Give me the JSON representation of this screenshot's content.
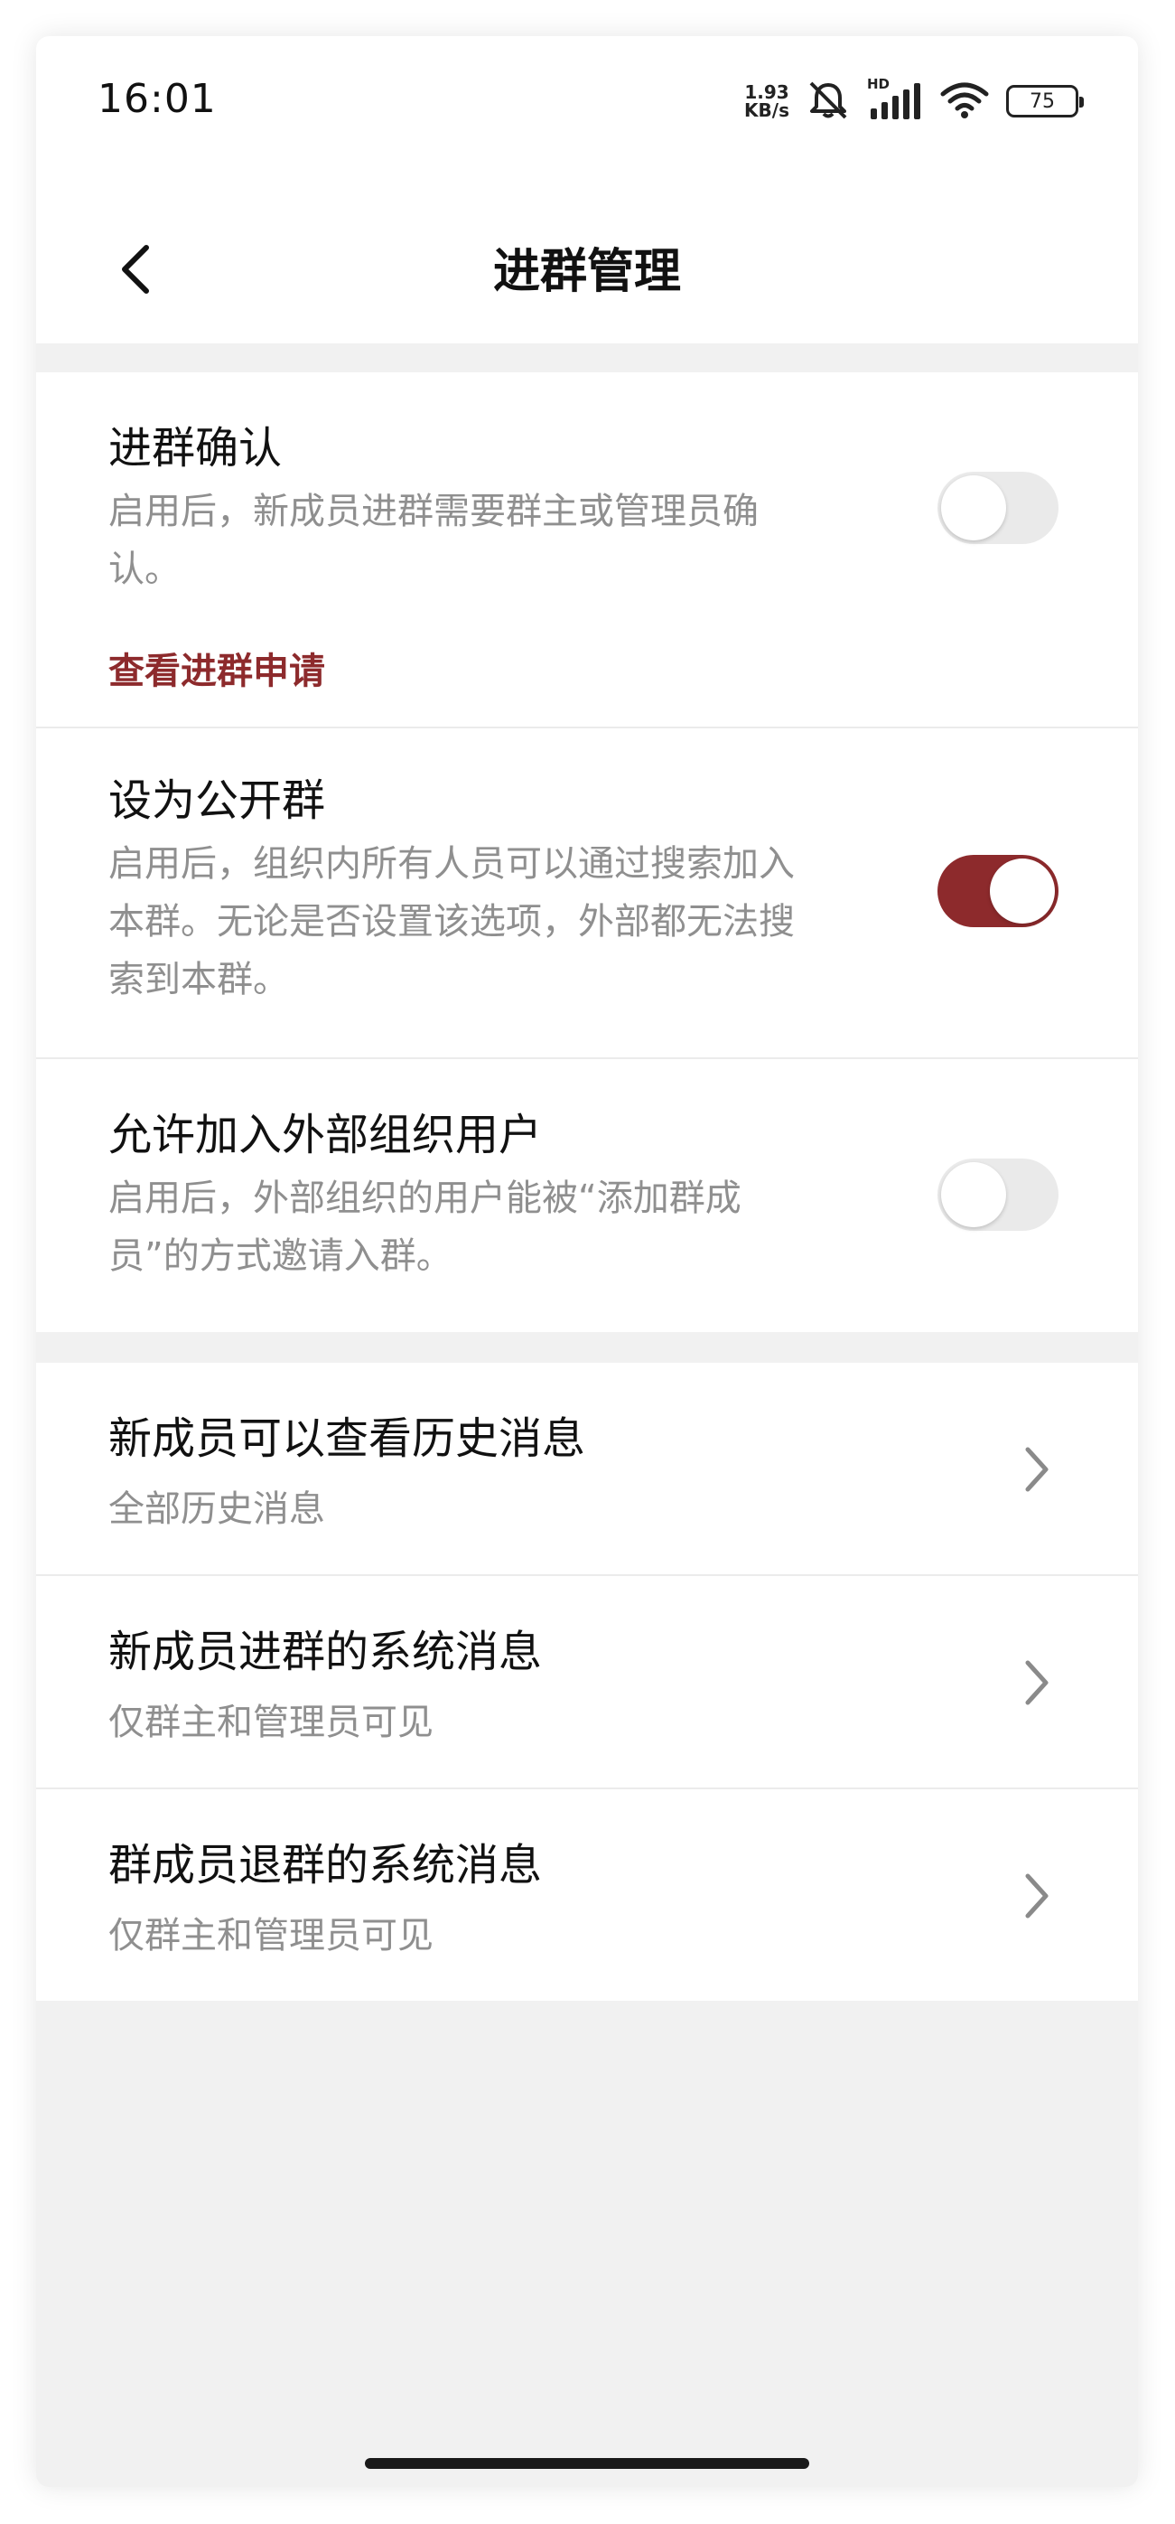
{
  "status_bar": {
    "time": "16:01",
    "net_speed_value": "1.93",
    "net_speed_unit": "KB/s",
    "signal_label": "HD",
    "battery": "75",
    "icons": [
      "mute-icon",
      "signal-icon",
      "wifi-icon",
      "battery-icon"
    ]
  },
  "nav": {
    "title": "进群管理",
    "back_icon": "chevron-left-icon"
  },
  "section_toggles": {
    "join_confirm": {
      "title": "进群确认",
      "desc": "启用后，新成员进群需要群主或管理员确认。",
      "link": "查看进群申请",
      "enabled": false
    },
    "public_group": {
      "title": "设为公开群",
      "desc": "启用后，组织内所有人员可以通过搜索加入本群。无论是否设置该选项，外部都无法搜索到本群。",
      "enabled": true
    },
    "external_users": {
      "title": "允许加入外部组织用户",
      "desc": "启用后，外部组织的用户能被“添加群成员”的方式邀请入群。",
      "enabled": false
    }
  },
  "section_messages": {
    "history": {
      "title": "新成员可以查看历史消息",
      "value": "全部历史消息"
    },
    "join_notice": {
      "title": "新成员进群的系统消息",
      "value": "仅群主和管理员可见"
    },
    "leave_notice": {
      "title": "群成员退群的系统消息",
      "value": "仅群主和管理员可见"
    }
  },
  "colors": {
    "accent": "#8d2a2c",
    "toggle_off": "#eaeaea",
    "secondary_text": "#8f8f8f",
    "background": "#f1f1f1"
  }
}
